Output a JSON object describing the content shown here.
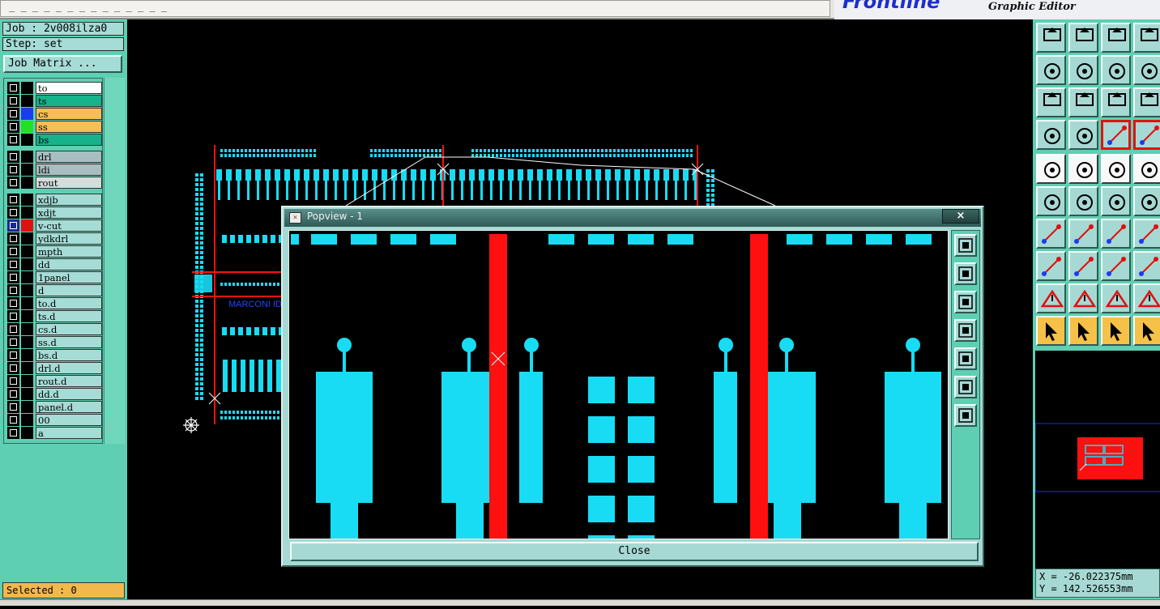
{
  "window": {
    "title_field_text": "_  _    _    _    _    _    _    _    _    _    _    _   _    _",
    "brand_logo": "Frontline",
    "brand_subtitle": "Graphic Editor"
  },
  "job": {
    "job_label": "Job : 2v008ilza0",
    "step_label": "Step: set",
    "job_matrix_button": "Job Matrix ..."
  },
  "layers": [
    {
      "name": "to",
      "bg": "#ffffff",
      "swatch": "#000000",
      "checked": false
    },
    {
      "name": "ts",
      "bg": "#18b28a",
      "swatch": "#000000",
      "checked": false
    },
    {
      "name": "cs",
      "bg": "#f5bf55",
      "swatch": "#1a3cf0",
      "checked": false
    },
    {
      "name": "ss",
      "bg": "#f5bf55",
      "swatch": "#22e022",
      "checked": false
    },
    {
      "name": "bs",
      "bg": "#18b28a",
      "swatch": "#000000",
      "checked": false
    },
    {
      "name": "drl",
      "bg": "#a8bec0",
      "swatch": "#000000",
      "checked": false
    },
    {
      "name": "ldi",
      "bg": "#a8bec0",
      "swatch": "#000000",
      "checked": false
    },
    {
      "name": "rout",
      "bg": "#d4dcdc",
      "swatch": "#000000",
      "checked": false
    },
    {
      "name": "xdjb",
      "bg": "#a5dcd6",
      "swatch": "#000000",
      "checked": false
    },
    {
      "name": "xdjt",
      "bg": "#a5dcd6",
      "swatch": "#000000",
      "checked": false
    },
    {
      "name": "v-cut",
      "bg": "#a5dcd6",
      "swatch": "#e01010",
      "checked": true
    },
    {
      "name": "ydkdrl",
      "bg": "#a5dcd6",
      "swatch": "#000000",
      "checked": false
    },
    {
      "name": "mpth",
      "bg": "#a5dcd6",
      "swatch": "#000000",
      "checked": false
    },
    {
      "name": "dd",
      "bg": "#a5dcd6",
      "swatch": "#000000",
      "checked": false
    },
    {
      "name": "1panel",
      "bg": "#a5dcd6",
      "swatch": "#000000",
      "checked": false
    },
    {
      "name": "d",
      "bg": "#a5dcd6",
      "swatch": "#000000",
      "checked": false
    },
    {
      "name": "to.d",
      "bg": "#a5dcd6",
      "swatch": "#000000",
      "checked": false
    },
    {
      "name": "ts.d",
      "bg": "#a5dcd6",
      "swatch": "#000000",
      "checked": false
    },
    {
      "name": "cs.d",
      "bg": "#a5dcd6",
      "swatch": "#000000",
      "checked": false
    },
    {
      "name": "ss.d",
      "bg": "#a5dcd6",
      "swatch": "#000000",
      "checked": false
    },
    {
      "name": "bs.d",
      "bg": "#a5dcd6",
      "swatch": "#000000",
      "checked": false
    },
    {
      "name": "drl.d",
      "bg": "#a5dcd6",
      "swatch": "#000000",
      "checked": false
    },
    {
      "name": "rout.d",
      "bg": "#a5dcd6",
      "swatch": "#000000",
      "checked": false
    },
    {
      "name": "dd.d",
      "bg": "#a5dcd6",
      "swatch": "#000000",
      "checked": false
    },
    {
      "name": "panel.d",
      "bg": "#a5dcd6",
      "swatch": "#000000",
      "checked": false
    },
    {
      "name": "00",
      "bg": "#a5dcd6",
      "swatch": "#000000",
      "checked": false
    },
    {
      "name": "a",
      "bg": "#a5dcd6",
      "swatch": "#000000",
      "checked": false
    }
  ],
  "status": {
    "selected_label": "Selected : 0",
    "coord_x": "X = -26.022375mm",
    "coord_y": "Y = 142.526553mm"
  },
  "board": {
    "text_label": "MARCONI ID"
  },
  "popview": {
    "title": "Popview - 1",
    "close_x": "×",
    "close_button": "Close"
  },
  "colors": {
    "pad": "#18dcf4",
    "vcut": "#ff1010",
    "panel_bg": "#5ecfb2",
    "button_face": "#a6d9d4"
  }
}
